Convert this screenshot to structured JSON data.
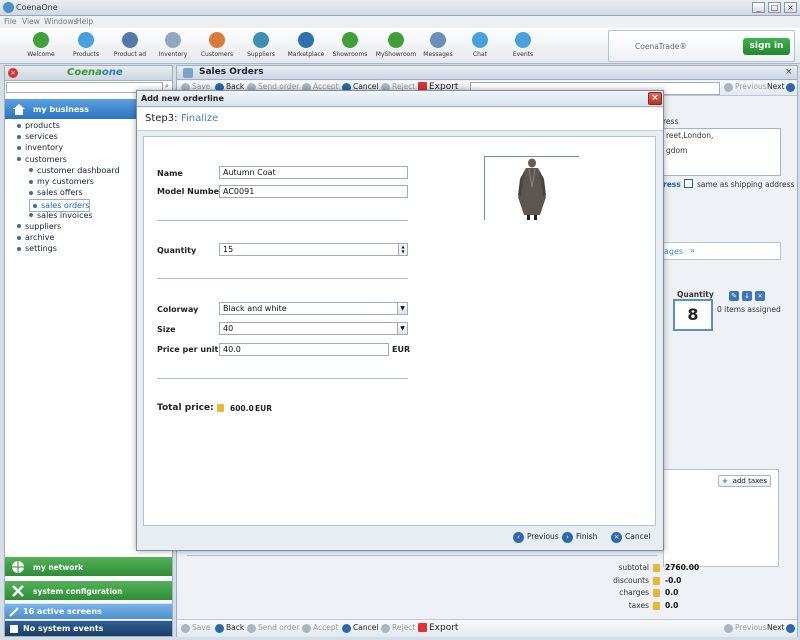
{
  "window": {
    "title": "CoenaOne",
    "controls": [
      "_",
      "□",
      "×"
    ]
  },
  "menu": [
    "File",
    "View",
    "Windows",
    "Help"
  ],
  "toolbar": [
    {
      "label": "Welcome",
      "icon": "welcome-icon",
      "color": "#3fa03a"
    },
    {
      "label": "Products",
      "icon": "products-icon",
      "color": "#4aa0dd"
    },
    {
      "label": "Product ad",
      "icon": "product-ad-icon",
      "color": "#5577aa"
    },
    {
      "label": "Inventory",
      "icon": "inventory-icon",
      "color": "#8fa8c0"
    },
    {
      "label": "Customers",
      "icon": "customers-icon",
      "color": "#d87a3a"
    },
    {
      "label": "Suppliers",
      "icon": "suppliers-icon",
      "color": "#3f8fb5"
    },
    {
      "label": "Marketplace",
      "icon": "marketplace-icon",
      "color": "#2f70b0"
    },
    {
      "label": "Showrooms",
      "icon": "showrooms-icon",
      "color": "#3fa03a"
    },
    {
      "label": "MyShowroom",
      "icon": "myshowroom-icon",
      "color": "#3fa03a"
    },
    {
      "label": "Messages",
      "icon": "messages-icon",
      "color": "#6a8fb8"
    },
    {
      "label": "Chat",
      "icon": "chat-icon",
      "color": "#4aa0dd"
    },
    {
      "label": "Events",
      "icon": "events-icon",
      "color": "#4aa0dd"
    }
  ],
  "trade": {
    "title": "CoenaTrade®",
    "signin": "sign in"
  },
  "left": {
    "logo_a": "Coena",
    "logo_b": "one",
    "section": "my business",
    "tree": [
      {
        "label": "products",
        "indent": 0
      },
      {
        "label": "services",
        "indent": 0
      },
      {
        "label": "inventory",
        "indent": 0
      },
      {
        "label": "customers",
        "indent": 0
      },
      {
        "label": "customer dashboard",
        "indent": 1
      },
      {
        "label": "my customers",
        "indent": 1
      },
      {
        "label": "sales offers",
        "indent": 1
      },
      {
        "label": "sales orders",
        "indent": 1,
        "selected": true
      },
      {
        "label": "sales invoices",
        "indent": 1
      },
      {
        "label": "suppliers",
        "indent": 0
      },
      {
        "label": "archive",
        "indent": 0
      },
      {
        "label": "settings",
        "indent": 0
      }
    ],
    "my_network": "my network",
    "system_config": "system configuration",
    "active_screens": "16 active screens",
    "system_events": "No system events"
  },
  "sales": {
    "title": "Sales Orders",
    "toolbar": {
      "save": "Save",
      "back": "Back",
      "send": "Send order",
      "accept": "Accept",
      "cancel": "Cancel",
      "reject": "Reject",
      "export": "Export"
    },
    "previous": "Previous",
    "next": "Next",
    "address_label": "ress",
    "address_lines": [
      "reet,London,",
      "gdom"
    ],
    "address_check_label": "ress",
    "same_shipping": "same as shipping address",
    "tab_label": "ages",
    "quantity_label": "Quantity",
    "quantity_value": "8",
    "items_assigned": "0  items assigned",
    "add_taxes": "add taxes",
    "summary": [
      {
        "label": "subtotal",
        "value": "2760.00"
      },
      {
        "label": "discounts",
        "value": "-0.0"
      },
      {
        "label": "charges",
        "value": "0.0"
      },
      {
        "label": "taxes",
        "value": "0.0"
      }
    ]
  },
  "dialog": {
    "title": "Add new orderline",
    "step_label": "Step3:",
    "step_name": "Finalize",
    "name_label": "Name",
    "name_value": "Autumn Coat",
    "model_label": "Model Number",
    "model_value": "AC0091",
    "quantity_label": "Quantity",
    "quantity_value": "15",
    "colorway_label": "Colorway",
    "colorway_value": "Black and white",
    "size_label": "Size",
    "size_value": "40",
    "price_label": "Price per unit",
    "price_value": "40.0",
    "currency": "EUR",
    "total_label": "Total price:",
    "total_value": "600.0",
    "total_currency": "EUR",
    "buttons": {
      "previous": "Previous",
      "finish": "Finish",
      "cancel": "Cancel"
    }
  }
}
